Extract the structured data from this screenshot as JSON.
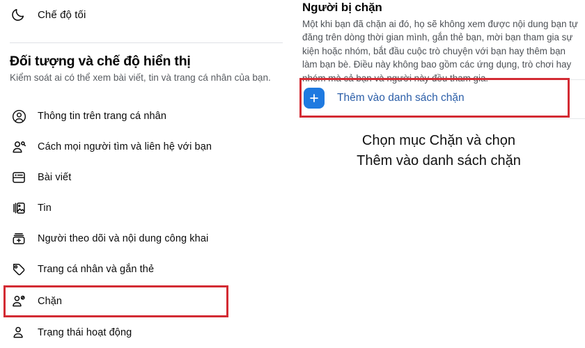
{
  "left": {
    "dark_mode": {
      "label": "Chế độ tối",
      "icon": "moon-icon"
    },
    "section": {
      "title": "Đối tượng và chế độ hiển thị",
      "subtitle": "Kiểm soát ai có thể xem bài viết, tin và trang cá nhân của bạn."
    },
    "items": [
      {
        "label": "Thông tin trên trang cá nhân",
        "icon": "user-circle-icon",
        "selected": false
      },
      {
        "label": "Cách mọi người tìm và liên hệ với bạn",
        "icon": "user-search-icon",
        "selected": false
      },
      {
        "label": "Bài viết",
        "icon": "post-card-icon",
        "selected": false
      },
      {
        "label": "Tin",
        "icon": "stories-photo-icon",
        "selected": false
      },
      {
        "label": "Người theo dõi và nội dung công khai",
        "icon": "follower-plus-icon",
        "selected": false
      },
      {
        "label": "Trang cá nhân và gắn thẻ",
        "icon": "tag-icon",
        "selected": false
      },
      {
        "label": "Chặn",
        "icon": "user-block-icon",
        "selected": true
      },
      {
        "label": "Trạng thái hoạt động",
        "icon": "user-active-icon",
        "selected": false
      }
    ]
  },
  "right": {
    "title": "Người bị chặn",
    "body": "Một khi bạn đã chặn ai đó, họ sẽ không xem được nội dung bạn tự đăng trên dòng thời gian mình, gắn thẻ bạn, mời bạn tham gia sự kiện hoặc nhóm, bắt đầu cuộc trò chuyện với bạn hay thêm bạn làm bạn bè. Điều này không bao gồm các ứng dụng, trò chơi hay nhóm mà cả bạn và người này đều tham gia.",
    "add_button": {
      "label": "Thêm vào danh sách chặn",
      "icon": "plus-icon"
    },
    "caption_line1": "Chọn mục Chặn và chọn",
    "caption_line2": "Thêm vào danh sách chặn"
  },
  "colors": {
    "highlight": "#d32b33",
    "accent_blue": "#1f7ae0",
    "link_blue": "#2b5ea8",
    "text_primary": "#050505",
    "text_secondary": "#585c61"
  }
}
